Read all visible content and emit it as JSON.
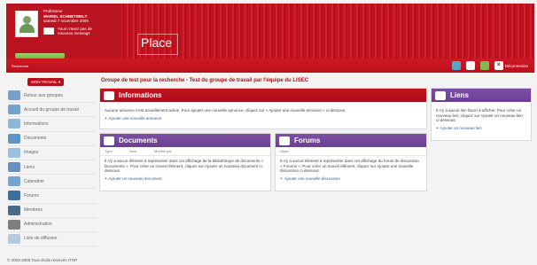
{
  "header": {
    "user_role": "Professeur",
    "user_name": "MARIEL SCHNETWELT",
    "user_date": "samedi 7 novembre 2009",
    "message_text": "Vous n'avez pas de nouveau message",
    "brand": "Place",
    "search_label": "Recherche",
    "logout_label": "Déconnexion"
  },
  "sidebar": {
    "workspace_button": "MON TRAVAIL",
    "items": [
      {
        "label": "Retour aux groupes"
      },
      {
        "label": "Accueil du groupe de travail"
      },
      {
        "label": "Informations"
      },
      {
        "label": "Documents"
      },
      {
        "label": "Images"
      },
      {
        "label": "Liens"
      },
      {
        "label": "Calendrier"
      },
      {
        "label": "Forums"
      },
      {
        "label": "Membres"
      },
      {
        "label": "Administration"
      },
      {
        "label": "Liste de diffusion"
      }
    ]
  },
  "main": {
    "page_title": "Groupe de test pour la recherche - Test du groupe de travail par l'équipe du LISEC",
    "informations": {
      "title": "Informations",
      "text": "Aucune annonce n'est actuellement active. Pour ajouter une nouvelle annonce, cliquez sur « Ajouter une nouvelle annonce » ci-dessous.",
      "link": "Ajouter une nouvelle annonce"
    },
    "documents": {
      "title": "Documents",
      "col_type": "Type",
      "col_nom": "Nom",
      "col_modifie": "Modifié par",
      "text": "Il n'y a aucun élément à représenter dans cet affichage de la bibliothèque de documents « Documents ». Pour créer un nouvel élément, cliquez sur Ajouter un nouveau document ci-dessous.",
      "link": "Ajouter un nouveau document"
    },
    "forums": {
      "title": "Forums",
      "col_objet": "Objet",
      "text": "Il n'y a aucun élément à représenter dans cet affichage du forum de discussion « Forums ». Pour créer un nouvel élément, cliquez sur Ajouter une nouvelle discussion ci-dessous.",
      "link": "Ajouter une nouvelle discussion"
    },
    "liens": {
      "title": "Liens",
      "text": "Il n'y a aucun lien favori à afficher. Pour créer un nouveau lien, cliquez sur Ajouter un nouveau lien ci-dessous.",
      "link": "Ajouter un nouveau lien"
    }
  },
  "footer": {
    "copyright": "© 2003-2009 Tous droits réservés ITOP"
  },
  "colors": {
    "brand_red": "#b8101b",
    "purple": "#6a3f93",
    "link_blue": "#375e9c"
  }
}
